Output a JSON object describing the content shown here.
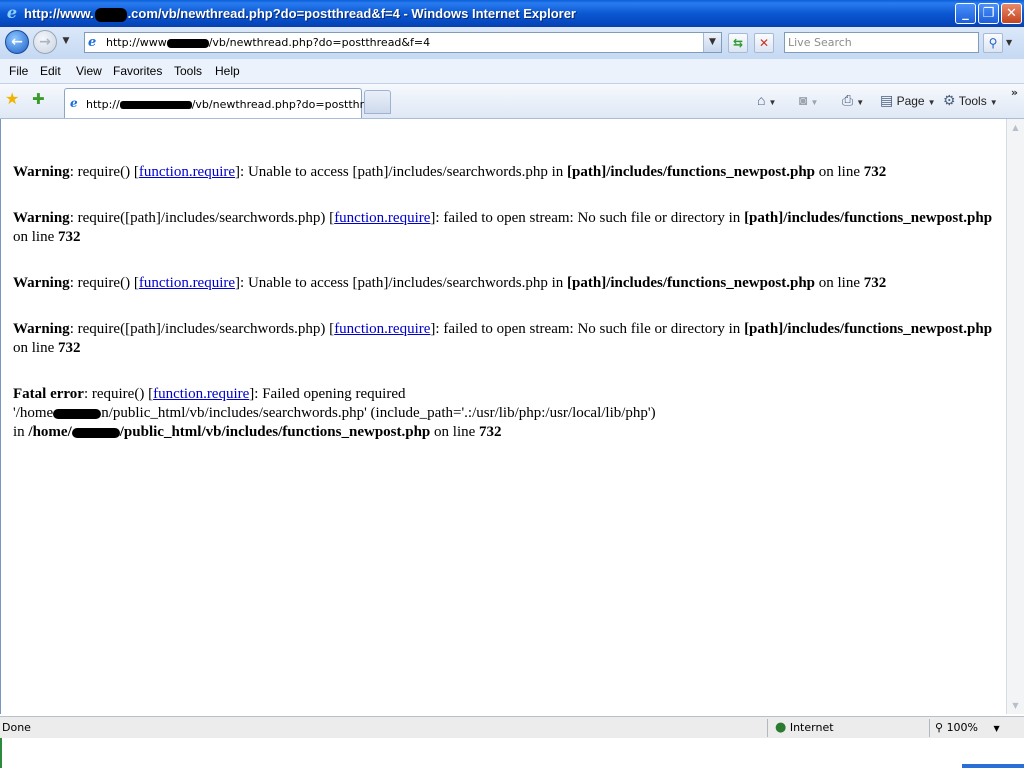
{
  "window": {
    "title_prefix": "http://www.",
    "title_suffix": ".com/vb/newthread.php?do=postthread&f=4 - Windows Internet Explorer",
    "controls": {
      "minimize": "_",
      "maximize": "❐",
      "close": "✕"
    }
  },
  "address_bar": {
    "url_prefix": "http://www",
    "url_suffix": "/vb/newthread.php?do=postthread&f=4",
    "search_placeholder": "Live Search"
  },
  "menu": [
    "File",
    "Edit",
    "View",
    "Favorites",
    "Tools",
    "Help"
  ],
  "tab": {
    "title_prefix": "http://",
    "title_suffix": "/vb/newthread.php?do=postthr..."
  },
  "command_bar": {
    "page_label": "Page",
    "tools_label": "Tools",
    "overflow": "»"
  },
  "errors": [
    {
      "label": "Warning",
      "pre": ": require() [",
      "link": "function.require",
      "post": "]: Unable to access [path]/includes/searchwords.php in ",
      "file": "[path]/includes/functions_newpost.php",
      "on_line": " on line ",
      "line": "732"
    },
    {
      "label": "Warning",
      "pre": ": require([path]/includes/searchwords.php) [",
      "link": "function.require",
      "post": "]: failed to open stream: No such file or directory in ",
      "file": "[path]/includes/functions_newpost.php",
      "on_line": " on line ",
      "line": "732"
    },
    {
      "label": "Warning",
      "pre": ": require() [",
      "link": "function.require",
      "post": "]: Unable to access [path]/includes/searchwords.php in ",
      "file": "[path]/includes/functions_newpost.php",
      "on_line": " on line ",
      "line": "732"
    },
    {
      "label": "Warning",
      "pre": ": require([path]/includes/searchwords.php) [",
      "link": "function.require",
      "post": "]: failed to open stream: No such file or directory in ",
      "file": "[path]/includes/functions_newpost.php",
      "on_line": " on line ",
      "line": "732"
    }
  ],
  "fatal": {
    "label": "Fatal error",
    "pre": ": require() [",
    "link": "function.require",
    "post": "]: Failed opening required",
    "path_prefix": "'/home",
    "path_suffix": "n/public_html/vb/includes/searchwords.php' (include_path='.:/usr/lib/php:/usr/local/lib/php')",
    "in_text": "in ",
    "file_prefix": "/home/",
    "file_suffix": "/public_html/vb/includes/functions_newpost.php",
    "on_line": " on line ",
    "line": "732"
  },
  "status": {
    "text": "Done",
    "zone": "Internet",
    "zoom": "100%"
  }
}
